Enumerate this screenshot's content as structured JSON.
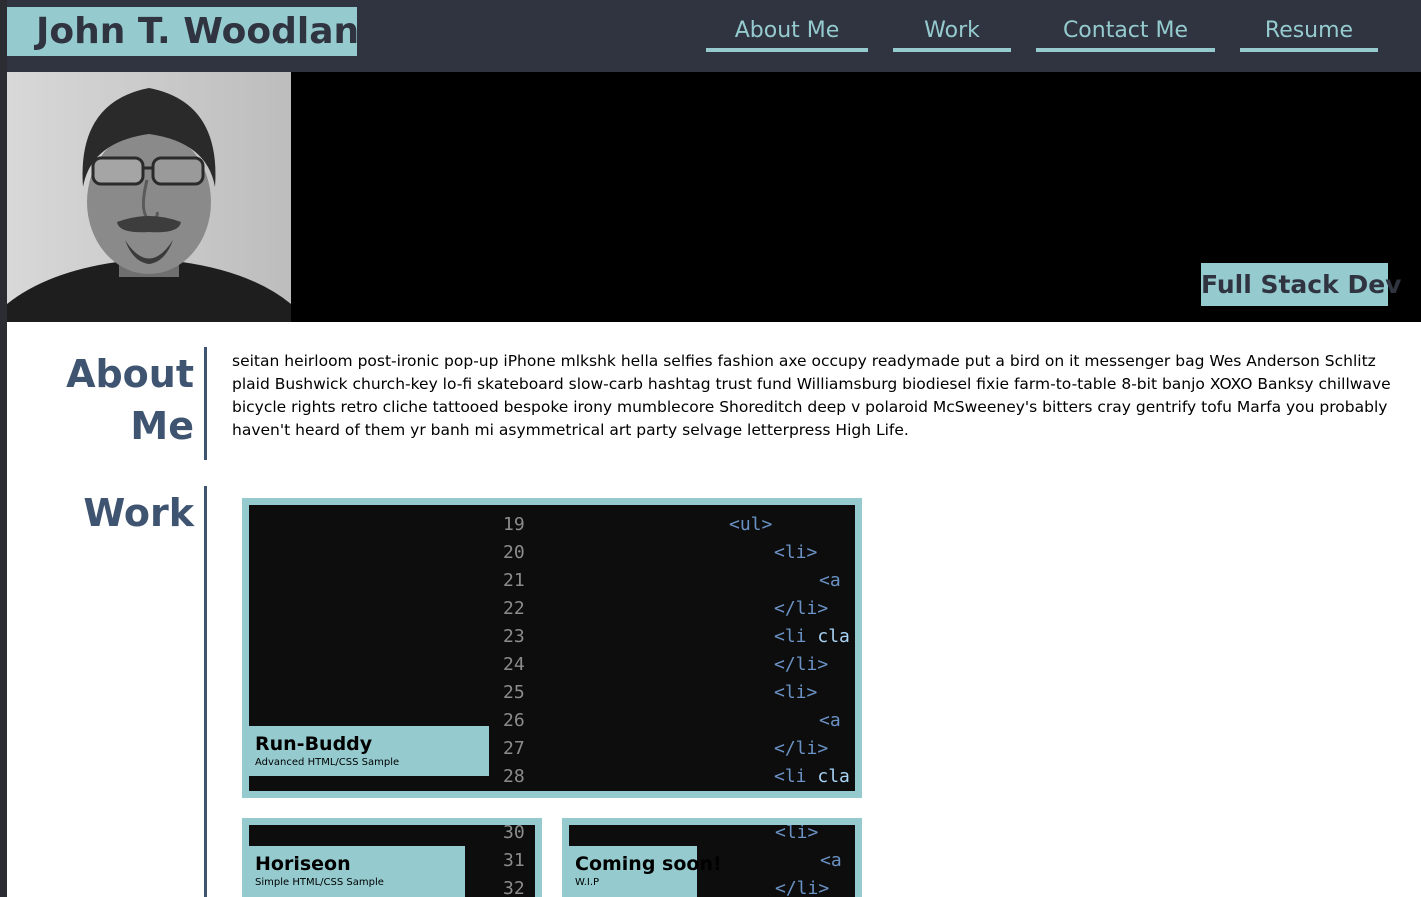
{
  "header": {
    "brand": "John T. Woodland",
    "nav": [
      "About Me",
      "Work",
      "Contact Me",
      "Resume"
    ]
  },
  "hero": {
    "tagline": "Full Stack Dev",
    "portrait_icon": "person-portrait"
  },
  "about": {
    "title_line1": "About",
    "title_line2": "Me",
    "text": "seitan heirloom post-ironic pop-up iPhone mlkshk hella selfies fashion axe occupy readymade put a bird on it messenger bag Wes Anderson Schlitz plaid Bushwick church-key lo-fi skateboard slow-carb hashtag trust fund Williamsburg biodiesel fixie farm-to-table 8-bit banjo XOXO Banksy chillwave bicycle rights retro cliche tattooed bespoke irony mumblecore Shoreditch deep v polaroid McSweeney's bitters cray gentrify tofu Marfa you probably haven't heard of them yr banh mi asymmetrical art party selvage letterpress High Life."
  },
  "work": {
    "title": "Work",
    "projects": [
      {
        "title": "Run-Buddy",
        "subtitle": "Advanced HTML/CSS Sample"
      },
      {
        "title": "Horiseon",
        "subtitle": "Simple HTML/CSS Sample"
      },
      {
        "title": "Coming soon!",
        "subtitle": "W.I.P"
      }
    ],
    "code_main": [
      {
        "n": "19",
        "code": "<ul>",
        "kind": "tag",
        "indent": 0
      },
      {
        "n": "20",
        "code": "<li>",
        "kind": "tag",
        "indent": 1
      },
      {
        "n": "21",
        "code": "<a",
        "kind": "tag",
        "indent": 2
      },
      {
        "n": "22",
        "code": "</li>",
        "kind": "tag",
        "indent": 1
      },
      {
        "n": "23",
        "code": "<li cla",
        "kind": "mixed",
        "indent": 1
      },
      {
        "n": "24",
        "code": "</li>",
        "kind": "tag",
        "indent": 1
      },
      {
        "n": "25",
        "code": "<li>",
        "kind": "tag",
        "indent": 1
      },
      {
        "n": "26",
        "code": "<a",
        "kind": "tag",
        "indent": 2
      },
      {
        "n": "27",
        "code": "</li>",
        "kind": "tag",
        "indent": 1
      },
      {
        "n": "28",
        "code": "<li cla",
        "kind": "mixed",
        "indent": 1
      }
    ],
    "code_small_left": [
      "30",
      "31",
      "32"
    ],
    "code_small_right": [
      {
        "code": "<li>",
        "indent": 0
      },
      {
        "code": "<a",
        "indent": 1
      },
      {
        "code": "</li>",
        "indent": 0
      }
    ]
  },
  "colors": {
    "accent": "#95cbcf",
    "header_bg": "#2f3440",
    "heading": "#3e5470"
  }
}
